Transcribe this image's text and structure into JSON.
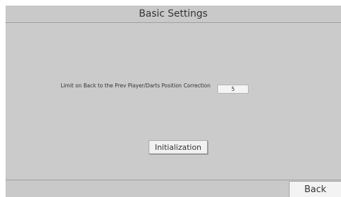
{
  "header": {
    "title": "Basic Settings"
  },
  "settings": {
    "limit_label": "Limit on Back to the Prev Player/Darts Position Correction",
    "limit_value": "5"
  },
  "buttons": {
    "initialization_label": "Initialization",
    "back_label": "Back"
  }
}
